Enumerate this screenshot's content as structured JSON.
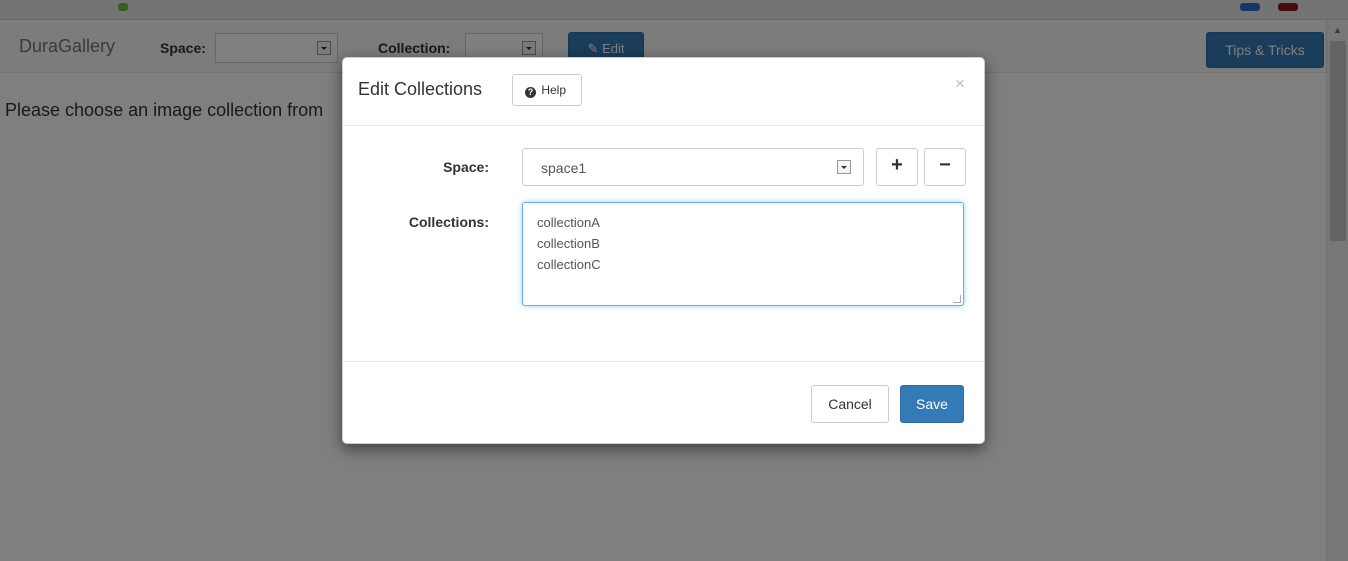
{
  "navbar": {
    "brand": "DuraGallery",
    "space_label": "Space:",
    "space_value": "",
    "collection_label": "Collection:",
    "collection_value": "",
    "edit_label": "Edit",
    "edit_icon": "edit-icon",
    "tips_label": "Tips & Tricks"
  },
  "page": {
    "message": "Please choose an image collection from"
  },
  "modal": {
    "title": "Edit Collections",
    "help_label": "Help",
    "help_icon": "question-circle-icon",
    "close_glyph": "×",
    "space_label": "Space:",
    "space_value": "space1",
    "add_label": "+",
    "remove_label": "−",
    "collections_label": "Collections:",
    "collections": [
      "collectionA",
      "collectionB",
      "collectionC"
    ],
    "cancel_label": "Cancel",
    "save_label": "Save"
  },
  "colors": {
    "primary": "#337ab7",
    "backdrop": "rgba(0,0,0,0.5)",
    "focus_border": "#66afe9"
  }
}
